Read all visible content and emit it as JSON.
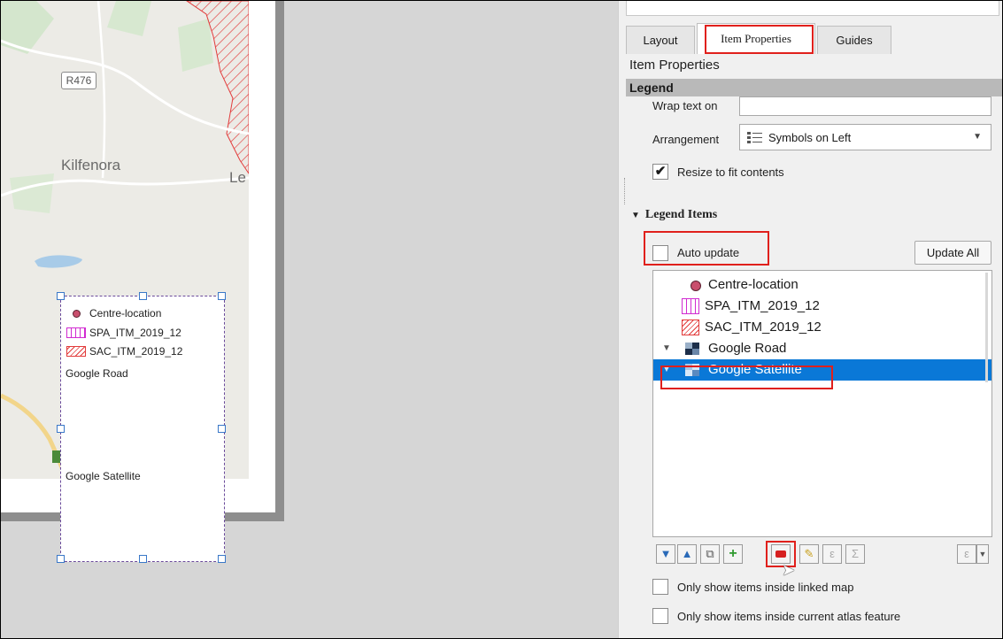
{
  "map": {
    "road_shield": "R476",
    "town_kilfenora": "Kilfenora",
    "town_partial": "Le"
  },
  "legend_preview": {
    "items": [
      "Centre-location",
      "SPA_ITM_2019_12",
      "SAC_ITM_2019_12",
      "Google Road",
      "Google Satellite"
    ]
  },
  "tabs": [
    {
      "label": "Layout"
    },
    {
      "label": "Item Properties"
    },
    {
      "label": "Guides"
    }
  ],
  "panel": {
    "title": "Item Properties",
    "section": "Legend",
    "wrap_text_label": "Wrap text on",
    "wrap_text_value": "",
    "arrangement_label": "Arrangement",
    "arrangement_value": "Symbols on Left",
    "resize_label": "Resize to fit contents",
    "resize_checked": true,
    "legend_items_header": "Legend Items",
    "auto_update_label": "Auto update",
    "auto_update_checked": false,
    "update_all_label": "Update All",
    "tree": [
      {
        "label": "Centre-location",
        "icon": "circle-marker-icon"
      },
      {
        "label": "SPA_ITM_2019_12",
        "icon": "vertical-hatch-icon"
      },
      {
        "label": "SAC_ITM_2019_12",
        "icon": "diagonal-hatch-icon"
      },
      {
        "label": "Google Road",
        "icon": "raster-layer-icon"
      },
      {
        "label": "Google Satellite",
        "icon": "raster-layer-icon",
        "selected": true
      }
    ],
    "only_inside_map_label": "Only show items inside linked map",
    "only_inside_atlas_label": "Only show items inside current atlas feature",
    "toolbar_glyphs": {
      "epsilon": "ε",
      "sigma": "Σ"
    }
  },
  "colors": {
    "selection": "#0a78d7",
    "highlight_box": "#e0201c",
    "spa_magenta": "#d12bd1",
    "sac_red": "#e23c3c",
    "centre_marker": "#c94f6d"
  }
}
